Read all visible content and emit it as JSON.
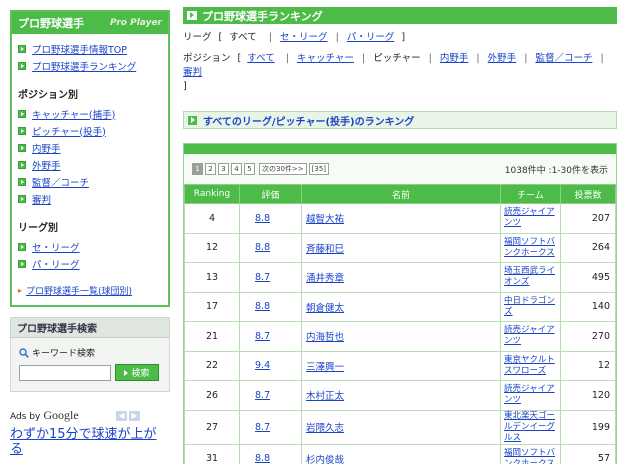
{
  "sidebar": {
    "header": {
      "title": "プロ野球選手",
      "sub": "Pro Player"
    },
    "top_links": [
      "プロ野球選手情報TOP",
      "プロ野球選手ランキング"
    ],
    "position_title": "ポジション別",
    "positions": [
      "キャッチャー(捕手)",
      "ピッチャー(投手)",
      "内野手",
      "外野手",
      "監督／コーチ",
      "審判"
    ],
    "league_title": "リーグ別",
    "leagues": [
      "セ・リーグ",
      "パ・リーグ"
    ],
    "all_link": "プロ野球選手一覧(球団別)",
    "search": {
      "title": "プロ野球選手検索",
      "keyword_label": "キーワード検索",
      "input_value": "",
      "button": "検索"
    },
    "ads": {
      "by": "Ads by",
      "google": "Google",
      "ad_text": "わずか15分で球速が上がる"
    },
    "colors": {
      "accent": "#4cbb48",
      "link": "#1a44c8"
    }
  },
  "main": {
    "title": "プロ野球選手ランキング",
    "league_label": "リーグ",
    "league_options": [
      "すべて",
      "セ・リーグ",
      "パ・リーグ"
    ],
    "position_label": "ポジション",
    "position_options": [
      "すべて",
      "キャッチャー",
      "ピッチャー",
      "内野手",
      "外野手",
      "監督／コーチ",
      "審判"
    ],
    "subtitle": "すべてのリーグ/ピッチャー(投手)のランキング",
    "pager": {
      "pages": [
        "1",
        "2",
        "3",
        "4",
        "5"
      ],
      "next": "次の30件>>",
      "last": "[35]",
      "count": "1038件中 :1-30件を表示"
    },
    "columns": [
      "Ranking",
      "評価",
      "名前",
      "チーム",
      "投票数"
    ],
    "rows": [
      {
        "rank": "4",
        "score": "8.8",
        "name": "越智大祐",
        "team": "読売ジャイアンツ",
        "votes": "207"
      },
      {
        "rank": "12",
        "score": "8.8",
        "name": "斉藤和巳",
        "team": "福岡ソフトバンクホークス",
        "votes": "264"
      },
      {
        "rank": "13",
        "score": "8.7",
        "name": "涌井秀章",
        "team": "埼玉西武ライオンズ",
        "votes": "495"
      },
      {
        "rank": "17",
        "score": "8.8",
        "name": "朝倉健太",
        "team": "中日ドラゴンズ",
        "votes": "140"
      },
      {
        "rank": "21",
        "score": "8.7",
        "name": "内海哲也",
        "team": "読売ジャイアンツ",
        "votes": "270"
      },
      {
        "rank": "22",
        "score": "9.4",
        "name": "三澤興一",
        "team": "東京ヤクルトスワローズ",
        "votes": "12"
      },
      {
        "rank": "26",
        "score": "8.7",
        "name": "木村正太",
        "team": "読売ジャイアンツ",
        "votes": "120"
      },
      {
        "rank": "27",
        "score": "8.7",
        "name": "岩隈久志",
        "team": "東北楽天ゴールデンイーグルス",
        "votes": "199"
      },
      {
        "rank": "31",
        "score": "8.8",
        "name": "杉内俊哉",
        "team": "福岡ソフトバンクホークス",
        "votes": "57"
      }
    ]
  }
}
